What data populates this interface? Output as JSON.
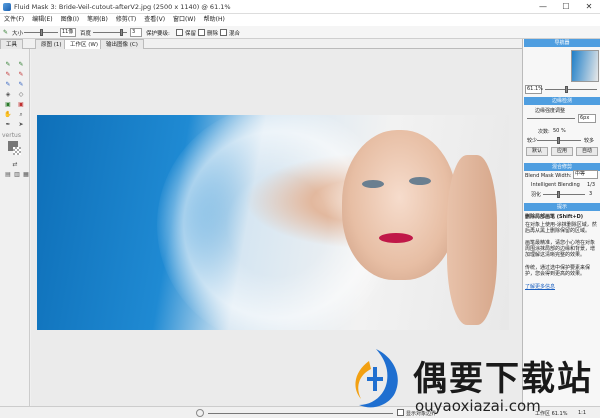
{
  "window": {
    "title": "Fluid Mask 3: Bride-Veil-cutout-afterV2.jpg (2500 x 1140) @ 61.1%",
    "minimize": "—",
    "maximize": "☐",
    "close": "✕"
  },
  "menu": [
    "文件(F)",
    "编辑(E)",
    "图像(I)",
    "笔刷(B)",
    "修剪(T)",
    "查看(V)",
    "窗口(W)",
    "帮助(H)"
  ],
  "toolbar": {
    "size_label": "大小",
    "size_value": "11像",
    "hardness_label": "百度",
    "hardness_value": "3",
    "protect_label": "保护要级:",
    "opt1": "保留",
    "opt2": "删除",
    "opt3": "混合"
  },
  "tabs": {
    "tools": "工具",
    "original": "原图 (1)",
    "workspace": "工作区 (W)",
    "output": "输出图像 (C)"
  },
  "tools_panel": {
    "brand": "vertus"
  },
  "right_panel": {
    "nav_head": "导航器",
    "zoom": "61.1%",
    "edge_head": "边缘检测",
    "edge_label": "边缘强度调整",
    "edge_value": "6px",
    "count_label": "次数:",
    "count_value": "50 %",
    "less": "较少",
    "more": "较多",
    "btn_reset": "默认",
    "btn_apply": "应用",
    "btn_auto": "自动",
    "blend_head": "混合修剪",
    "blend_mask": "Blend Mask Width:",
    "blend_mask_value": "中等",
    "intel_blend": "Intelligent Blending",
    "intel_value": "1/3",
    "feather": "羽化",
    "feather_value": "3",
    "help_head": "提示",
    "help_title": "删除局部画笔 (Shift+D)",
    "help_p1": "在对象上使用-涂抹删除区域，然后再从黑上删除保留的区域。",
    "help_p2": "画笔最精准，请您小心地在对象周围涂抹局部的边缘和背景，增加理解这清晰完整的效果。",
    "help_p3": "传统，通过选中保护要素来保护，您会得到更高的效果。",
    "help_link": "了解更多信息"
  },
  "status": {
    "show_changes": "显示对象边界",
    "zoom_readout": "工作区 61.1%",
    "ratio": "1:1"
  },
  "watermark": {
    "cn": "偶要下载站",
    "en": "ouyaoxiazai.com"
  }
}
